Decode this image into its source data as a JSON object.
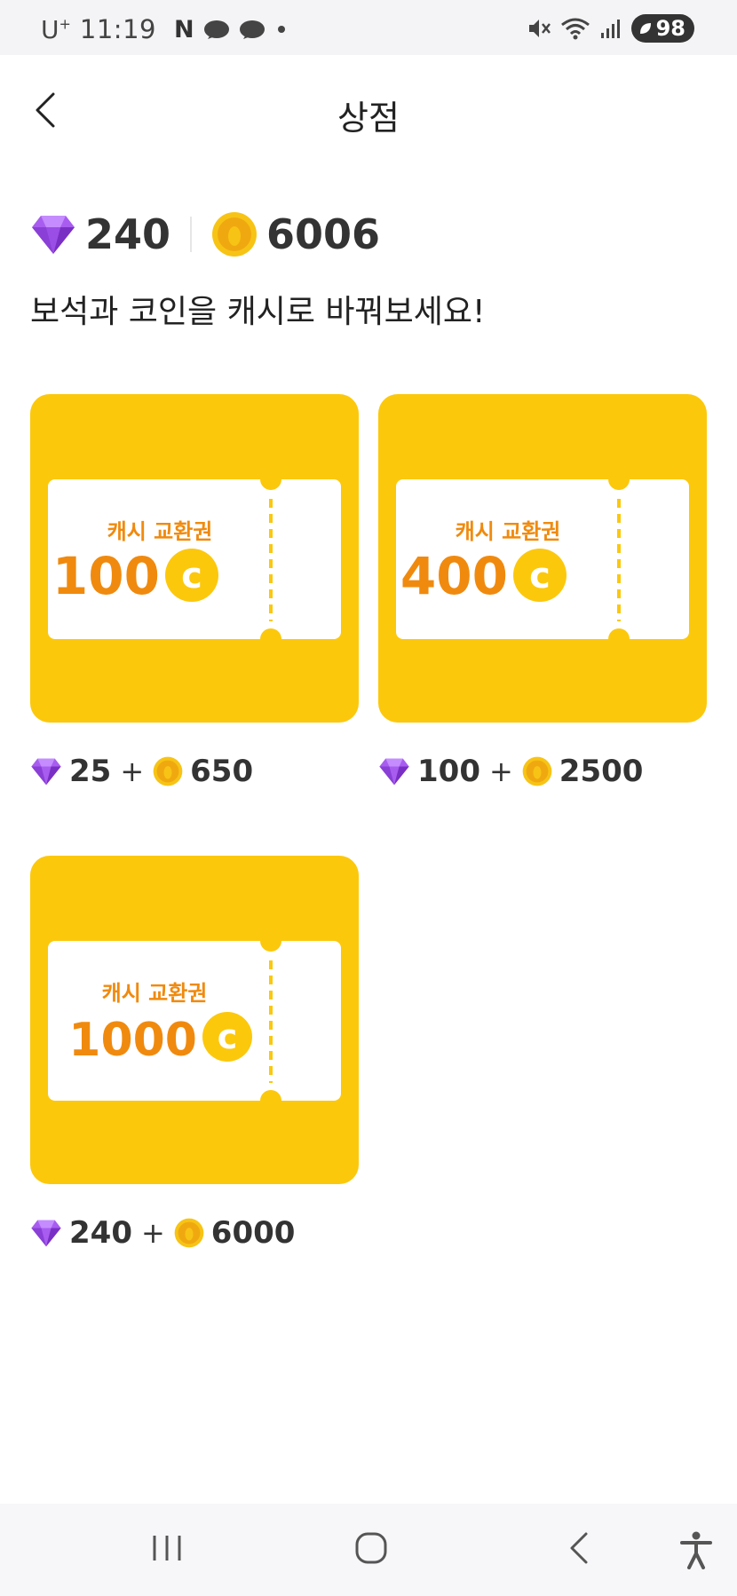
{
  "status_bar": {
    "carrier": "U",
    "carrier_sup": "+",
    "time": "11:19",
    "n_label": "N",
    "battery": "98"
  },
  "header": {
    "title": "상점"
  },
  "balance": {
    "gems": "240",
    "coins": "6006"
  },
  "subtitle": "보석과 코인을 캐시로 바꿔보세요!",
  "products": [
    {
      "ticket_label": "캐시 교환권",
      "ticket_amount": "100",
      "gem_cost": "25",
      "coin_cost": "650"
    },
    {
      "ticket_label": "캐시 교환권",
      "ticket_amount": "400",
      "gem_cost": "100",
      "coin_cost": "2500"
    },
    {
      "ticket_label": "캐시 교환권",
      "ticket_amount": "1000",
      "gem_cost": "240",
      "coin_cost": "6000"
    }
  ],
  "price_plus": "+",
  "colors": {
    "card_yellow": "#fcc80c",
    "ticket_orange": "#f08a0e",
    "gem_purple": "#9b4de0",
    "coin_gold": "#f7c415"
  },
  "icons": {
    "gem": "gem-icon",
    "coin": "coin-icon",
    "back": "back-arrow-icon",
    "recents": "recents-icon",
    "home": "home-icon",
    "nav_back": "nav-back-icon",
    "accessibility": "accessibility-icon"
  }
}
